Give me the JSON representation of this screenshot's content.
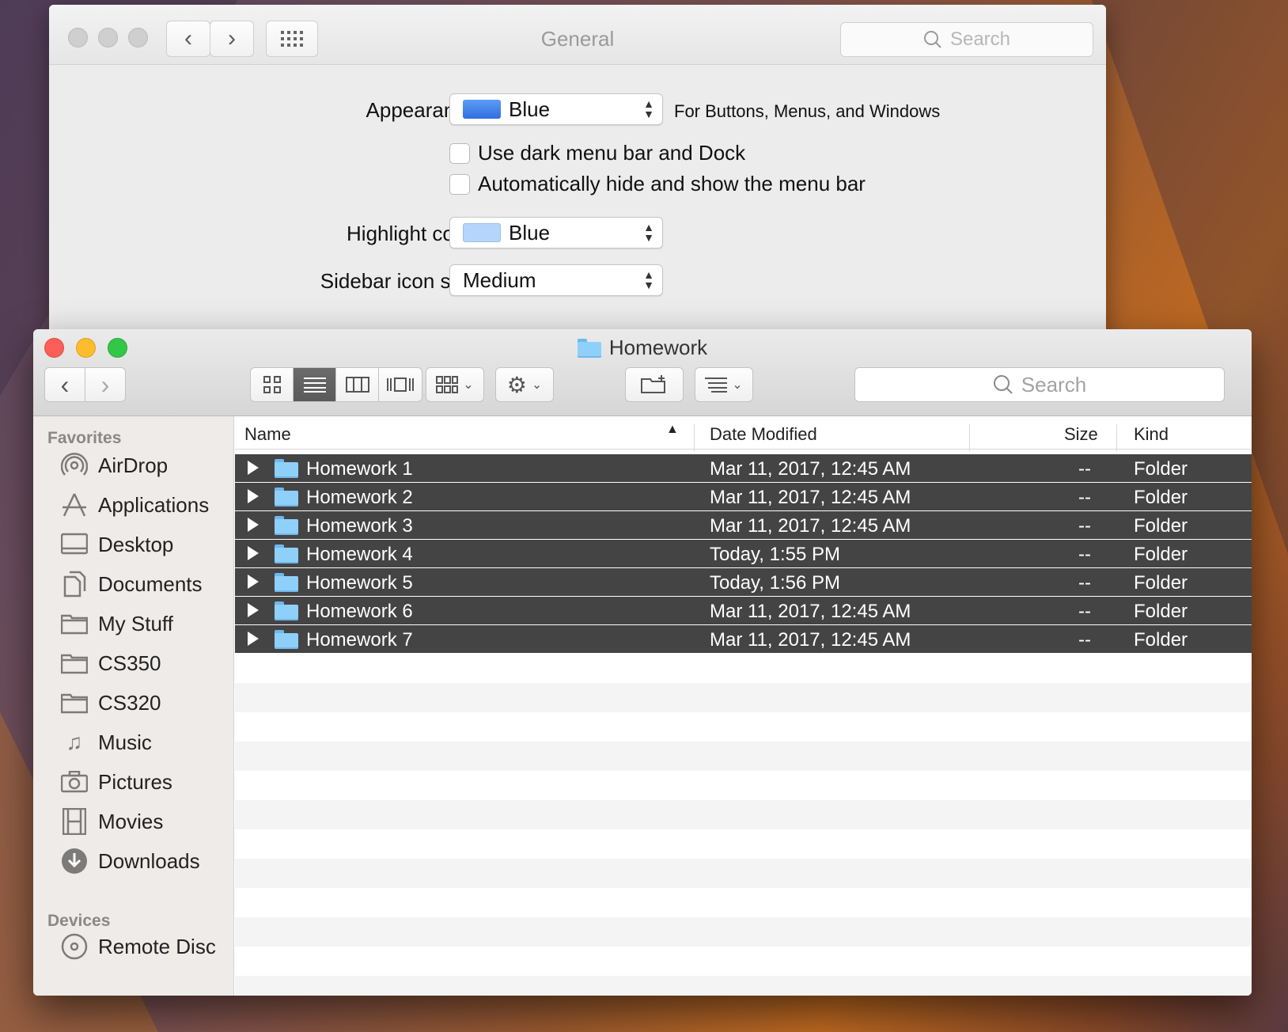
{
  "prefs": {
    "title": "General",
    "search_placeholder": "Search",
    "appearance": {
      "label": "Appearance:",
      "value": "Blue",
      "swatch": "#3b82f0",
      "note": "For Buttons, Menus, and Windows"
    },
    "dark_menu": {
      "label": "Use dark menu bar and Dock",
      "checked": false
    },
    "auto_hide": {
      "label": "Automatically hide and show the menu bar",
      "checked": false
    },
    "highlight": {
      "label": "Highlight color:",
      "value": "Blue",
      "swatch": "#b5d5fb"
    },
    "sidebar_icon": {
      "label": "Sidebar icon size:",
      "value": "Medium"
    }
  },
  "finder": {
    "title": "Homework",
    "search_placeholder": "Search",
    "columns": {
      "name": "Name",
      "date": "Date Modified",
      "size": "Size",
      "kind": "Kind"
    },
    "rows": [
      {
        "name": "Homework 1",
        "date": "Mar 11, 2017, 12:45 AM",
        "size": "--",
        "kind": "Folder"
      },
      {
        "name": "Homework 2",
        "date": "Mar 11, 2017, 12:45 AM",
        "size": "--",
        "kind": "Folder"
      },
      {
        "name": "Homework 3",
        "date": "Mar 11, 2017, 12:45 AM",
        "size": "--",
        "kind": "Folder"
      },
      {
        "name": "Homework 4",
        "date": "Today, 1:55 PM",
        "size": "--",
        "kind": "Folder"
      },
      {
        "name": "Homework 5",
        "date": "Today, 1:56 PM",
        "size": "--",
        "kind": "Folder"
      },
      {
        "name": "Homework 6",
        "date": "Mar 11, 2017, 12:45 AM",
        "size": "--",
        "kind": "Folder"
      },
      {
        "name": "Homework 7",
        "date": "Mar 11, 2017, 12:45 AM",
        "size": "--",
        "kind": "Folder"
      }
    ],
    "sidebar": {
      "favorites_label": "Favorites",
      "favorites": [
        {
          "label": "AirDrop",
          "icon": "airdrop-icon"
        },
        {
          "label": "Applications",
          "icon": "applications-icon"
        },
        {
          "label": "Desktop",
          "icon": "desktop-icon"
        },
        {
          "label": "Documents",
          "icon": "documents-icon"
        },
        {
          "label": "My Stuff",
          "icon": "folder-icon"
        },
        {
          "label": "CS350",
          "icon": "folder-icon"
        },
        {
          "label": "CS320",
          "icon": "folder-icon"
        },
        {
          "label": "Music",
          "icon": "music-icon"
        },
        {
          "label": "Pictures",
          "icon": "camera-icon"
        },
        {
          "label": "Movies",
          "icon": "film-icon"
        },
        {
          "label": "Downloads",
          "icon": "downloads-icon"
        }
      ],
      "devices_label": "Devices",
      "devices": [
        {
          "label": "Remote Disc",
          "icon": "disc-icon"
        }
      ]
    }
  }
}
